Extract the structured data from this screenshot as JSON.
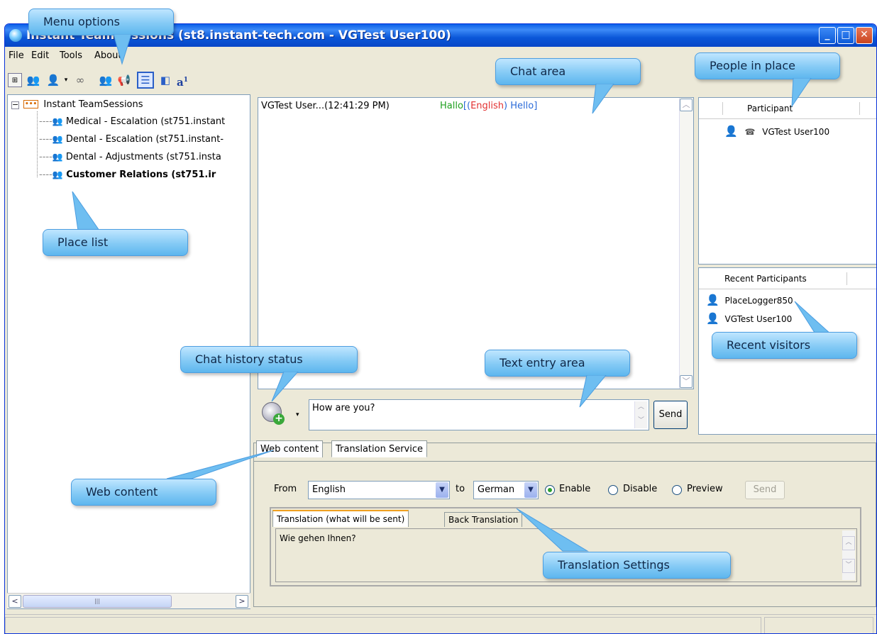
{
  "window": {
    "title": "Instant TeamSessions (st8.instant-tech.com - VGTest User100)"
  },
  "menu": [
    "File",
    "Edit",
    "Tools",
    "About"
  ],
  "places": {
    "root": "Instant TeamSessions",
    "items": [
      {
        "label": "Medical - Escalation (st751.instant",
        "bold": false
      },
      {
        "label": "Dental - Escalation (st751.instant-",
        "bold": false
      },
      {
        "label": "Dental - Adjustments (st751.insta",
        "bold": false
      },
      {
        "label": "Customer Relations (st751.ir",
        "bold": true
      }
    ]
  },
  "chat": {
    "sender": "VGTest User...(12:41:29 PM)",
    "msg_translated": "Hallo",
    "msg_bracket_open": "[(",
    "msg_lang": "English",
    "msg_close": ")",
    "msg_original": "Hello]"
  },
  "entry": {
    "value": "How are you?",
    "send": "Send"
  },
  "participants": {
    "header": "Participant",
    "users": [
      "VGTest User100"
    ]
  },
  "recent": {
    "header": "Recent Participants",
    "users": [
      "PlaceLogger850",
      "VGTest User100"
    ]
  },
  "tabs": [
    "Web content",
    "Translation Service"
  ],
  "translation": {
    "from_label": "From",
    "from_value": "English",
    "to_label": "to",
    "to_value": "German",
    "enable": "Enable",
    "disable": "Disable",
    "preview": "Preview",
    "send": "Send",
    "inner_tabs": [
      "Translation (what will be sent)",
      "Back Translation"
    ],
    "text": "Wie gehen Ihnen?"
  },
  "callouts": {
    "menu_options": "Menu options",
    "chat_area": "Chat area",
    "people_in_place": "People in place",
    "place_list": "Place list",
    "chat_history": "Chat history status",
    "text_entry": "Text entry area",
    "recent_visitors": "Recent visitors",
    "web_content": "Web content",
    "translation_settings": "Translation Settings"
  },
  "colors": {
    "callout": "#84caf5",
    "title_bar": "#0a5ee8",
    "lang_red": "#e23030",
    "blue_text": "#2a6ad8",
    "green_text": "#20a020"
  }
}
